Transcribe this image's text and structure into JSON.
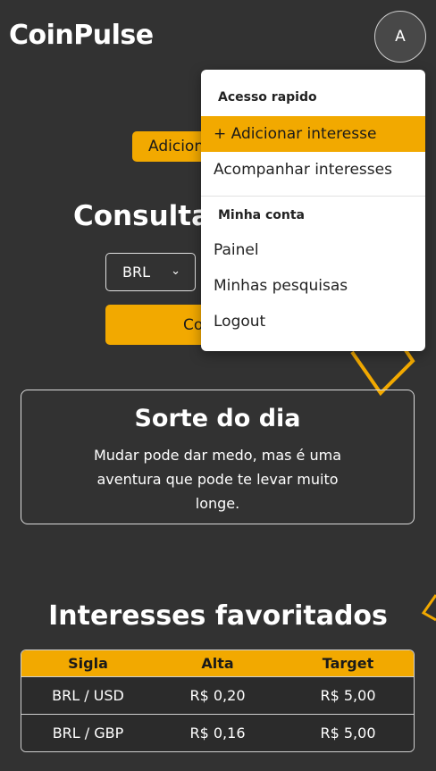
{
  "header": {
    "brand": "CoinPulse",
    "avatar_initial": "A"
  },
  "main": {
    "add_interest_label": "Adicionar interesse",
    "consult_title": "Consultar cotação",
    "currency_selected": "BRL",
    "consult_button_label": "Consultar"
  },
  "fortune": {
    "title": "Sorte do dia",
    "text": "Mudar pode dar medo, mas é uma aventura que pode te levar muito longe."
  },
  "favorites": {
    "title": "Interesses favoritados",
    "columns": [
      "Sigla",
      "Alta",
      "Target"
    ],
    "rows": [
      [
        "BRL / USD",
        "R$ 0,20",
        "R$ 5,00"
      ],
      [
        "BRL / GBP",
        "R$ 0,16",
        "R$ 5,00"
      ]
    ]
  },
  "dropdown": {
    "section1_header": "Acesso rapido",
    "add_interest": "+ Adicionar interesse",
    "track_interests": "Acompanhar interesses",
    "section2_header": "Minha conta",
    "dashboard": "Painel",
    "my_searches": "Minhas pesquisas",
    "logout": "Logout"
  },
  "colors": {
    "background": "#323232",
    "accent": "#f2a900",
    "menu_bg": "#ffffff"
  }
}
